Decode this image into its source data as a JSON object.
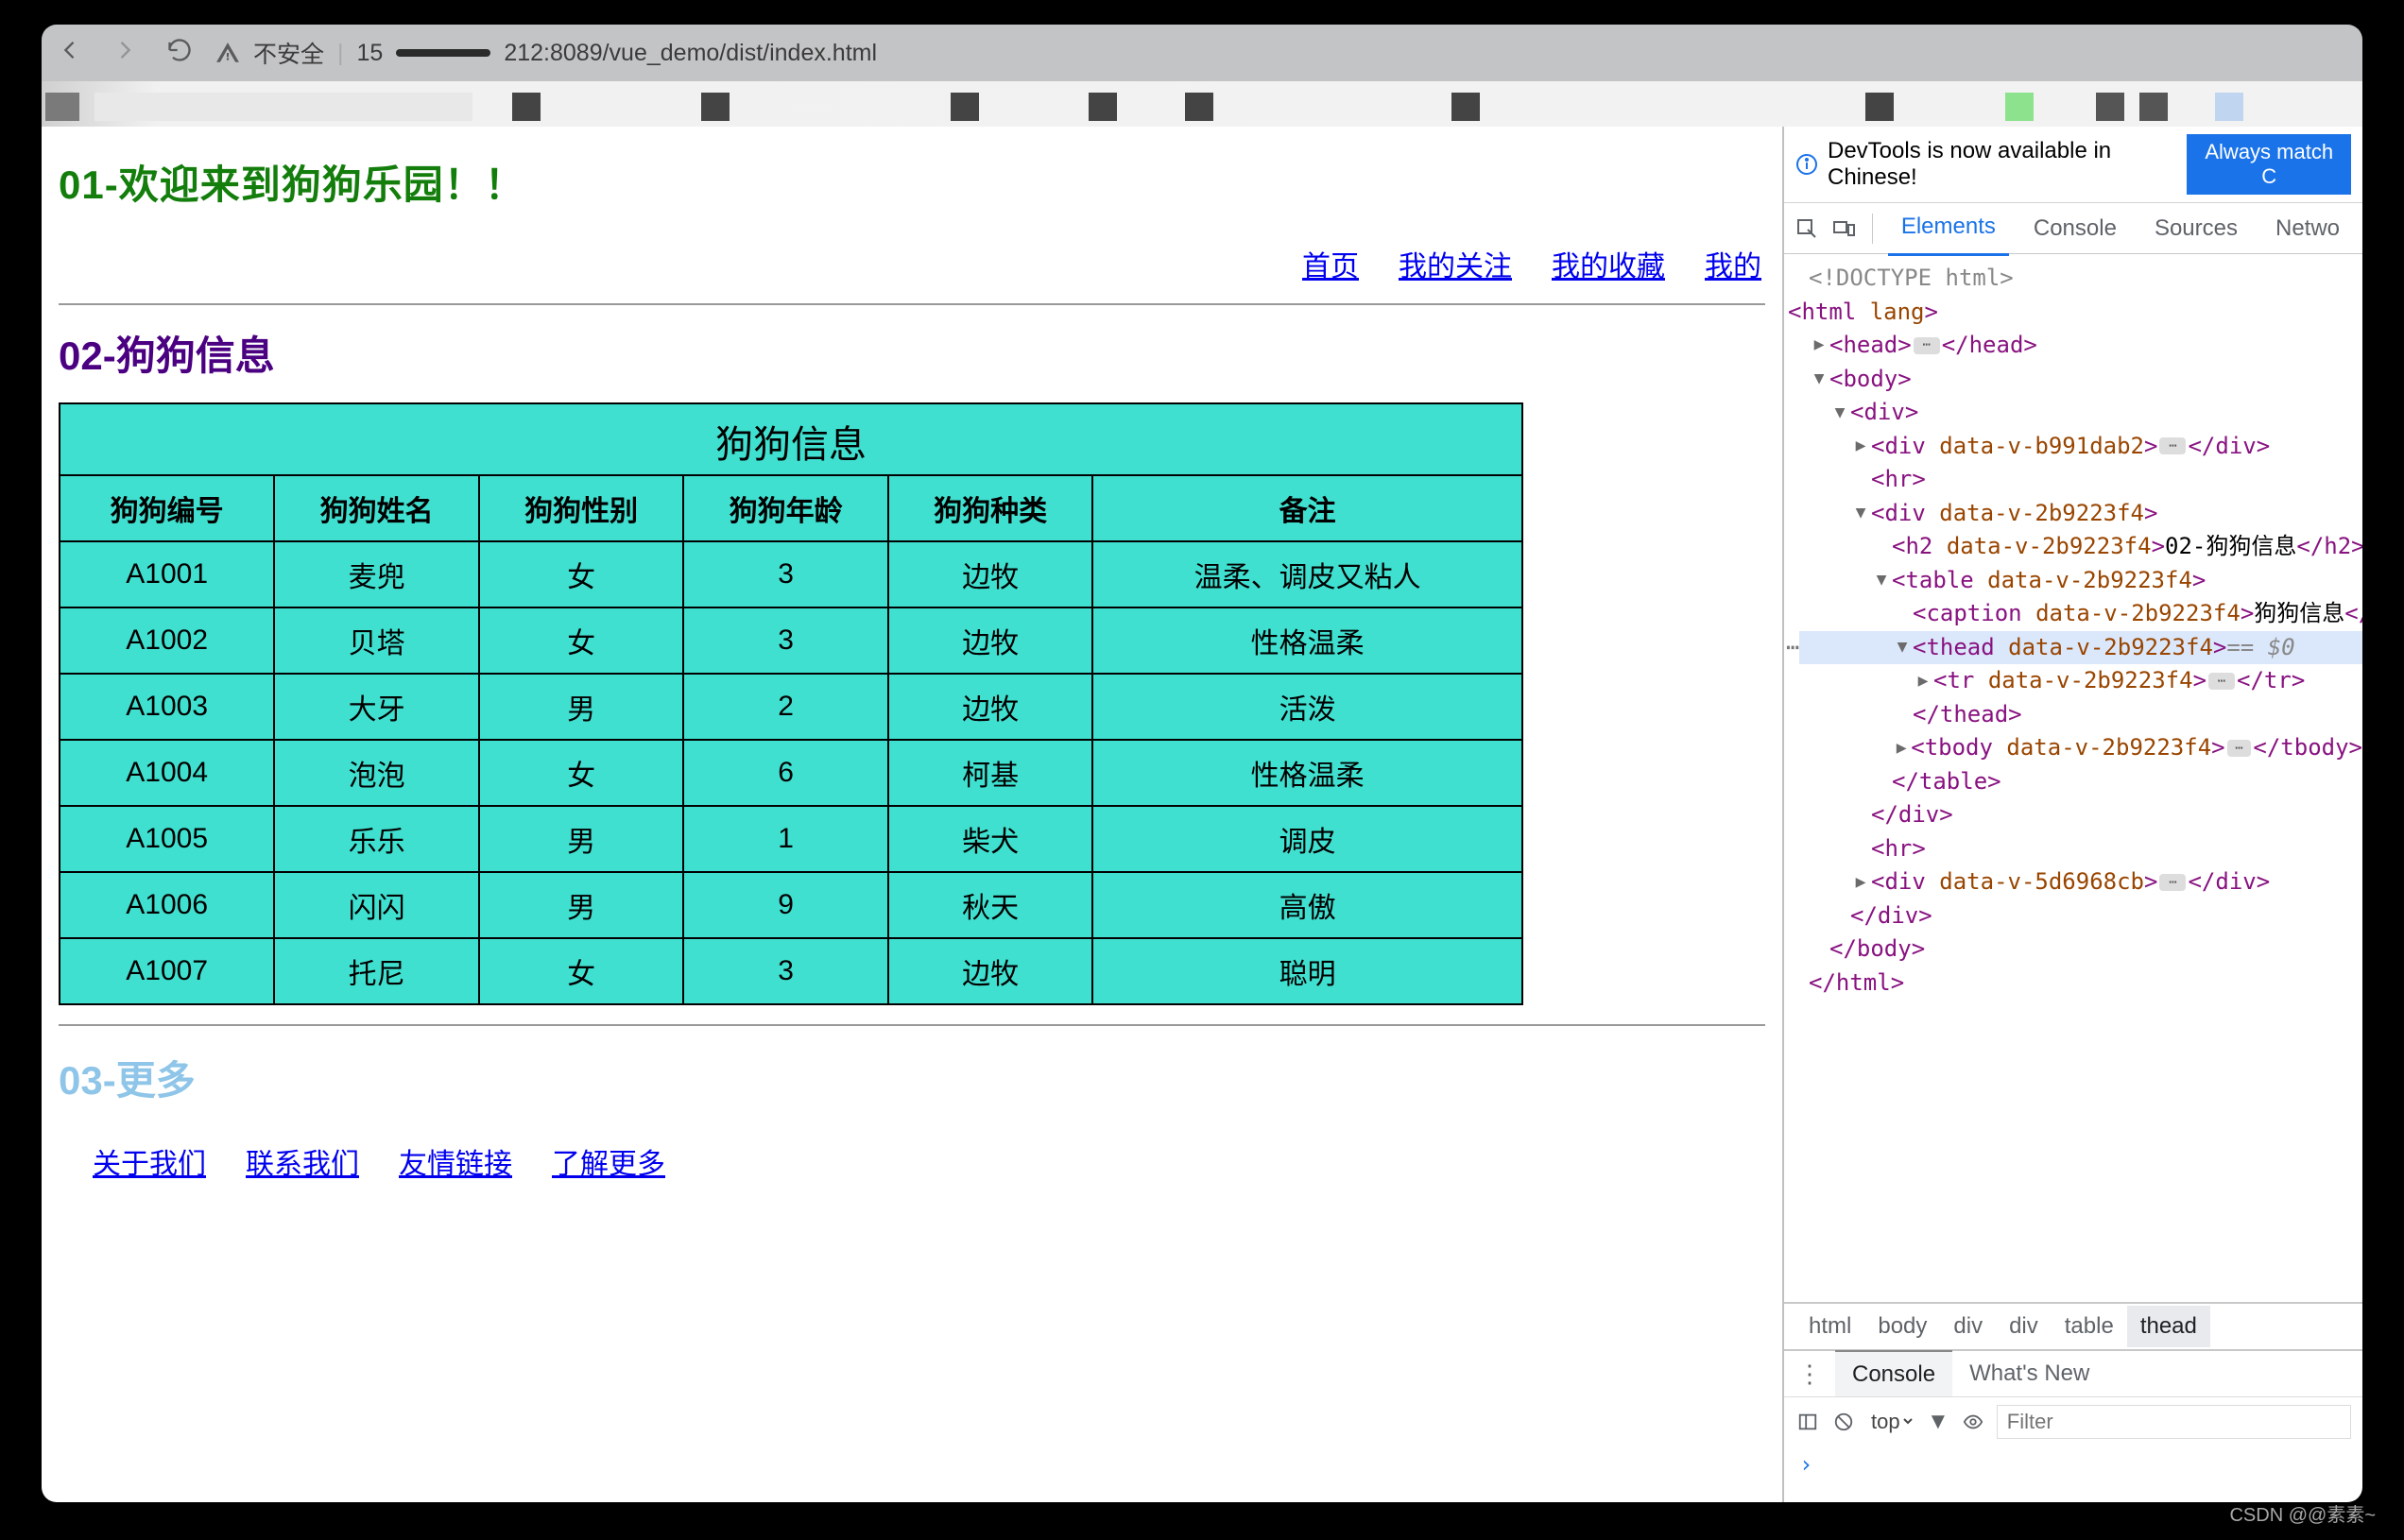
{
  "browser": {
    "insecure_label": "不安全",
    "url_prefix": "15",
    "url_suffix": "212:8089/vue_demo/dist/index.html"
  },
  "page": {
    "heading1": "01-欢迎来到狗狗乐园！！",
    "nav": {
      "home": "首页",
      "follow": "我的关注",
      "fav": "我的收藏",
      "mine": "我的"
    },
    "heading2": "02-狗狗信息",
    "table": {
      "caption": "狗狗信息",
      "headers": [
        "狗狗编号",
        "狗狗姓名",
        "狗狗性别",
        "狗狗年龄",
        "狗狗种类",
        "备注"
      ],
      "rows": [
        [
          "A1001",
          "麦兜",
          "女",
          "3",
          "边牧",
          "温柔、调皮又粘人"
        ],
        [
          "A1002",
          "贝塔",
          "女",
          "3",
          "边牧",
          "性格温柔"
        ],
        [
          "A1003",
          "大牙",
          "男",
          "2",
          "边牧",
          "活泼"
        ],
        [
          "A1004",
          "泡泡",
          "女",
          "6",
          "柯基",
          "性格温柔"
        ],
        [
          "A1005",
          "乐乐",
          "男",
          "1",
          "柴犬",
          "调皮"
        ],
        [
          "A1006",
          "闪闪",
          "男",
          "9",
          "秋天",
          "高傲"
        ],
        [
          "A1007",
          "托尼",
          "女",
          "3",
          "边牧",
          "聪明"
        ]
      ]
    },
    "heading3": "03-更多",
    "links": {
      "about": "关于我们",
      "contact": "联系我们",
      "friends": "友情链接",
      "learn": "了解更多"
    }
  },
  "devtools": {
    "banner_text": "DevTools is now available in Chinese!",
    "banner_btn": "Always match C",
    "tabs": {
      "elements": "Elements",
      "console": "Console",
      "sources": "Sources",
      "network": "Netwo"
    },
    "dom": {
      "doctype": "<!DOCTYPE html>",
      "html_open": "html",
      "html_attr": "lang",
      "head": "head",
      "body": "body",
      "div": "div",
      "attr_b991dab2": "data-v-b991dab2",
      "attr_2b9223f4": "data-v-2b9223f4",
      "attr_5d6968cb": "data-v-5d6968cb",
      "hr": "hr",
      "h2": "h2",
      "h2_text": "02-狗狗信息",
      "table": "table",
      "caption": "caption",
      "caption_text": "狗狗信息",
      "thead": "thead",
      "tr": "tr",
      "tbody": "tbody",
      "eq0": " == $0",
      "close_table": "</table>",
      "close_div": "</div>",
      "close_body": "</body>",
      "close_html": "</html>",
      "close_thead": "</thead>",
      "close_h2": "</h2>"
    },
    "breadcrumb": [
      "html",
      "body",
      "div",
      "div",
      "table",
      "thead"
    ],
    "drawer_tabs": {
      "console": "Console",
      "whatsnew": "What's New"
    },
    "console_bar": {
      "scope": "top",
      "filter_placeholder": "Filter"
    },
    "console_prompt": "›"
  },
  "watermark": "CSDN @@素素~"
}
